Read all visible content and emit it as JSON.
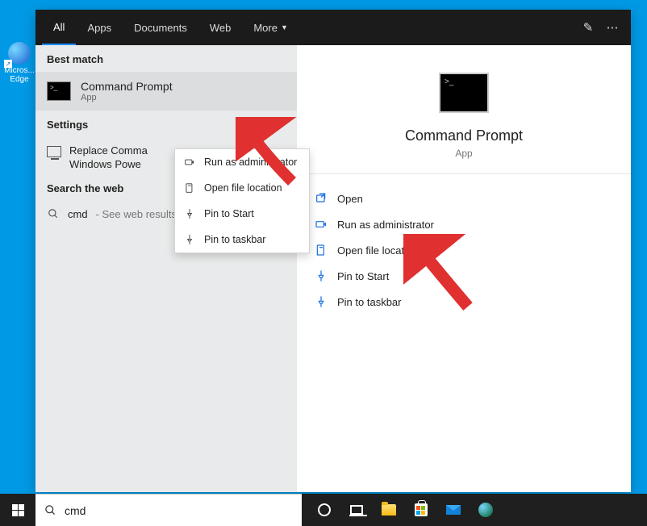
{
  "desktop_icon_label": "Micros...\nEdge",
  "tabs": {
    "all": "All",
    "apps": "Apps",
    "documents": "Documents",
    "web": "Web",
    "more": "More"
  },
  "best_match_header": "Best match",
  "best_match": {
    "title": "Command Prompt",
    "subtitle": "App"
  },
  "settings_header": "Settings",
  "settings_item": "Replace Command Prompt with Windows PowerShell",
  "settings_item_display": "Replace Comma\nWindows Powe",
  "web_header": "Search the web",
  "web_query": "cmd",
  "web_hint": "- See web results",
  "context_menu": {
    "run_admin": "Run as administrator",
    "open_loc": "Open file location",
    "pin_start": "Pin to Start",
    "pin_task": "Pin to taskbar"
  },
  "right": {
    "title": "Command Prompt",
    "subtitle": "App",
    "actions": {
      "open": "Open",
      "run_admin": "Run as administrator",
      "open_loc": "Open file location",
      "pin_start": "Pin to Start",
      "pin_task": "Pin to taskbar"
    }
  },
  "search_box_value": "cmd"
}
